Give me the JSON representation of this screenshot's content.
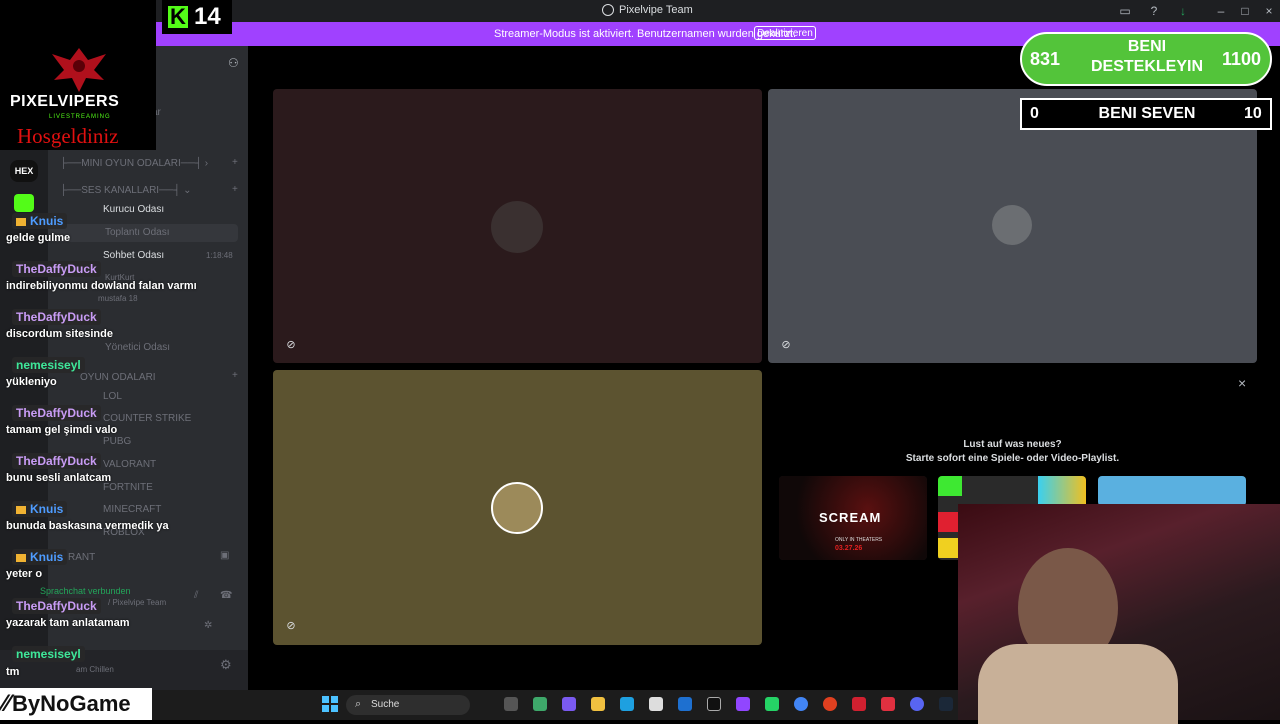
{
  "window": {
    "title": "Pixelvipe Team"
  },
  "banner": {
    "text": "Streamer-Modus ist aktiviert. Benutzernamen wurden gekürzt.",
    "button": "Deaktivieren"
  },
  "kick": {
    "count": "14"
  },
  "overlay": {
    "brand": "PIXELVIPERS",
    "brand_sub": "LIVESTREAMING",
    "welcome": "Hosgeldiniz"
  },
  "sidebar": {
    "server_labels": [
      "HEX"
    ],
    "channels": [
      {
        "label": "ar",
        "kind": "text"
      },
      {
        "label": "MINI OYUN ODALARI",
        "kind": "category"
      },
      {
        "label": "SES KANALLARI",
        "kind": "category"
      },
      {
        "label": "Kurucu Odası",
        "kind": "voice"
      },
      {
        "label": "Toplantı Odası",
        "kind": "voice"
      },
      {
        "label": "Sohbet Odası",
        "kind": "voice",
        "time": "1:18:48"
      },
      {
        "label": "Yönetici Odası",
        "kind": "voice"
      },
      {
        "label": "OYUN ODALARI",
        "kind": "category"
      },
      {
        "label": "LOL",
        "kind": "voice"
      },
      {
        "label": "COUNTER STRIKE",
        "kind": "voice"
      },
      {
        "label": "PUBG",
        "kind": "voice"
      },
      {
        "label": "VALORANT",
        "kind": "voice"
      },
      {
        "label": "FORTNITE",
        "kind": "voice"
      },
      {
        "label": "MINECRAFT",
        "kind": "voice"
      },
      {
        "label": "ROBLOX",
        "kind": "voice"
      },
      {
        "label": "RANT",
        "kind": "voice"
      }
    ],
    "members": [
      "KurtKurt",
      "mustafa 18"
    ],
    "voice_status": "Sprachchat verbunden",
    "voice_server": "/ Pixelvipe Team",
    "user_status": "am Chillen"
  },
  "chat": [
    {
      "user": "Knuis",
      "color": "#4e9cff",
      "badge": true,
      "msg": "gelde gulme"
    },
    {
      "user": "TheDaffyDuck",
      "color": "#c99cf5",
      "badge": false,
      "msg": "indirebiliyonmu dowland falan varmı"
    },
    {
      "user": "TheDaffyDuck",
      "color": "#c99cf5",
      "badge": false,
      "msg": "discordum sitesinde"
    },
    {
      "user": "nemesiseyl",
      "color": "#3ee89a",
      "badge": false,
      "msg": "yükleniyo"
    },
    {
      "user": "TheDaffyDuck",
      "color": "#c99cf5",
      "badge": false,
      "msg": "tamam gel şimdi valo"
    },
    {
      "user": "TheDaffyDuck",
      "color": "#c99cf5",
      "badge": false,
      "msg": "bunu sesli anlatcam"
    },
    {
      "user": "Knuis",
      "color": "#4e9cff",
      "badge": true,
      "msg": "bunuda baskasına vermedik ya"
    },
    {
      "user": "Knuis",
      "color": "#4e9cff",
      "badge": true,
      "msg": "yeter o"
    },
    {
      "user": "TheDaffyDuck",
      "color": "#c99cf5",
      "badge": false,
      "msg": "yazarak tam anlatamam"
    },
    {
      "user": "nemesiseyl",
      "color": "#3ee89a",
      "badge": false,
      "msg": "tm"
    }
  ],
  "tiles": [
    {
      "bg": "#2b1a1c",
      "avatar": "#3a3030"
    },
    {
      "bg": "#4a4d54",
      "avatar": "#6b6e72"
    },
    {
      "bg": "#5c5330",
      "avatar": "#9c8a5a"
    }
  ],
  "promo": {
    "line1": "Lust auf was neues?",
    "line2": "Starte sofort eine Spiele- oder Video-Playlist.",
    "card1_title": "SCREAM",
    "card1_sub": "ONLY IN THEATERS",
    "card1_date": "03.27.26"
  },
  "scores": {
    "goal_left": "831",
    "goal_label_1": "BENI",
    "goal_label_2": "DESTEKLEYIN",
    "goal_right": "1100",
    "love_left": "0",
    "love_label": "BENI SEVEN",
    "love_right": "10"
  },
  "taskbar": {
    "search": "Suche"
  },
  "sponsor": {
    "label": "ByNoGame"
  },
  "colors": {
    "banner": "#a041ff",
    "kick": "#53fc18",
    "score_green": "#53c43a",
    "sidebar": "#2b2d31"
  }
}
